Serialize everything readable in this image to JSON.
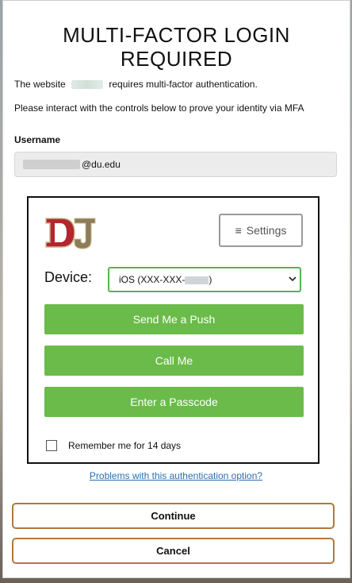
{
  "header": {
    "title": "MULTI-FACTOR LOGIN REQUIRED"
  },
  "intro": {
    "website_prefix": "The website",
    "website_suffix": "requires multi-factor authentication.",
    "instructions": "Please interact with the controls below to prove your identity via MFA"
  },
  "username": {
    "label": "Username",
    "value_suffix": "@du.edu"
  },
  "mfa": {
    "logo_text": "DU",
    "settings_icon": "≡",
    "settings_label": "Settings",
    "device_label": "Device:",
    "device_value_prefix": "iOS (XXX-XXX-",
    "device_value_suffix": ")",
    "buttons": {
      "push": "Send Me a Push",
      "call": "Call Me",
      "passcode": "Enter a Passcode"
    },
    "remember_label": "Remember me for 14 days"
  },
  "problems_link": "Problems with this authentication option?",
  "actions": {
    "continue": "Continue",
    "cancel": "Cancel"
  },
  "colors": {
    "accent_green": "#6bbb4b",
    "button_border": "#b07a3e",
    "logo_red": "#b1262f"
  }
}
